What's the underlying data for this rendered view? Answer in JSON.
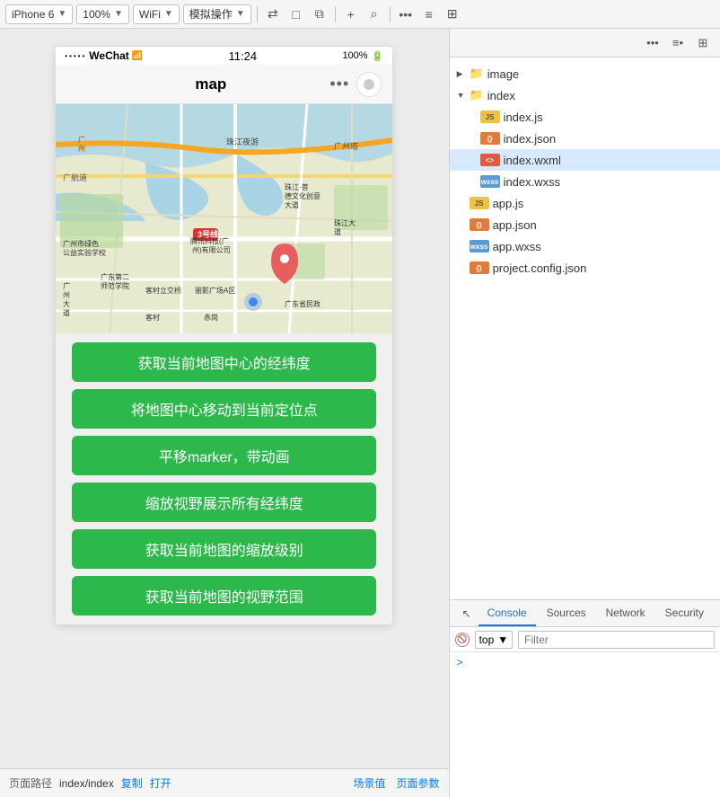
{
  "toolbar": {
    "device": "iPhone 6",
    "zoom": "100%",
    "network": "WiFi",
    "mode": "模拟操作",
    "icons": [
      "←→",
      "□",
      "⊡",
      "+",
      "🔍",
      "•••",
      "≡•",
      "⊞"
    ]
  },
  "phone": {
    "status_bar": {
      "dots": "•••••",
      "wechat": "WeChat",
      "wifi": "WiFi",
      "time": "11:24",
      "battery_pct": "100%"
    },
    "nav_bar": {
      "title": "map",
      "dots": "•••"
    },
    "buttons": [
      "获取当前地图中心的经纬度",
      "将地图中心移动到当前定位点",
      "平移marker，带动画",
      "缩放视野展示所有经纬度",
      "获取当前地图的缩放级别",
      "获取当前地图的视野范围"
    ]
  },
  "file_tree": {
    "items": [
      {
        "type": "folder",
        "name": "image",
        "level": 0,
        "expanded": false,
        "arrow": "▶"
      },
      {
        "type": "folder",
        "name": "index",
        "level": 0,
        "expanded": true,
        "arrow": "▼"
      },
      {
        "type": "js",
        "name": "index.js",
        "level": 1,
        "label": "JS"
      },
      {
        "type": "json",
        "name": "index.json",
        "level": 1,
        "label": "{}"
      },
      {
        "type": "wxml",
        "name": "index.wxml",
        "level": 1,
        "label": "<>"
      },
      {
        "type": "wxss",
        "name": "index.wxss",
        "level": 1,
        "label": "wxss"
      },
      {
        "type": "js",
        "name": "app.js",
        "level": 0,
        "label": "JS"
      },
      {
        "type": "json",
        "name": "app.json",
        "level": 0,
        "label": "{}"
      },
      {
        "type": "wxss",
        "name": "app.wxss",
        "level": 0,
        "label": "wxss"
      },
      {
        "type": "json",
        "name": "project.config.json",
        "level": 0,
        "label": "{}"
      }
    ]
  },
  "console": {
    "tabs": [
      "Console",
      "Sources",
      "Network",
      "Security"
    ],
    "active_tab": "Console",
    "filter_placeholder": "Filter",
    "top_value": "top",
    "arrow": ">"
  },
  "bottom_bar": {
    "label": "页面路径",
    "path": "index/index",
    "copy": "复制",
    "open": "打开",
    "scene_label": "场景值",
    "page_params": "页面参数"
  }
}
